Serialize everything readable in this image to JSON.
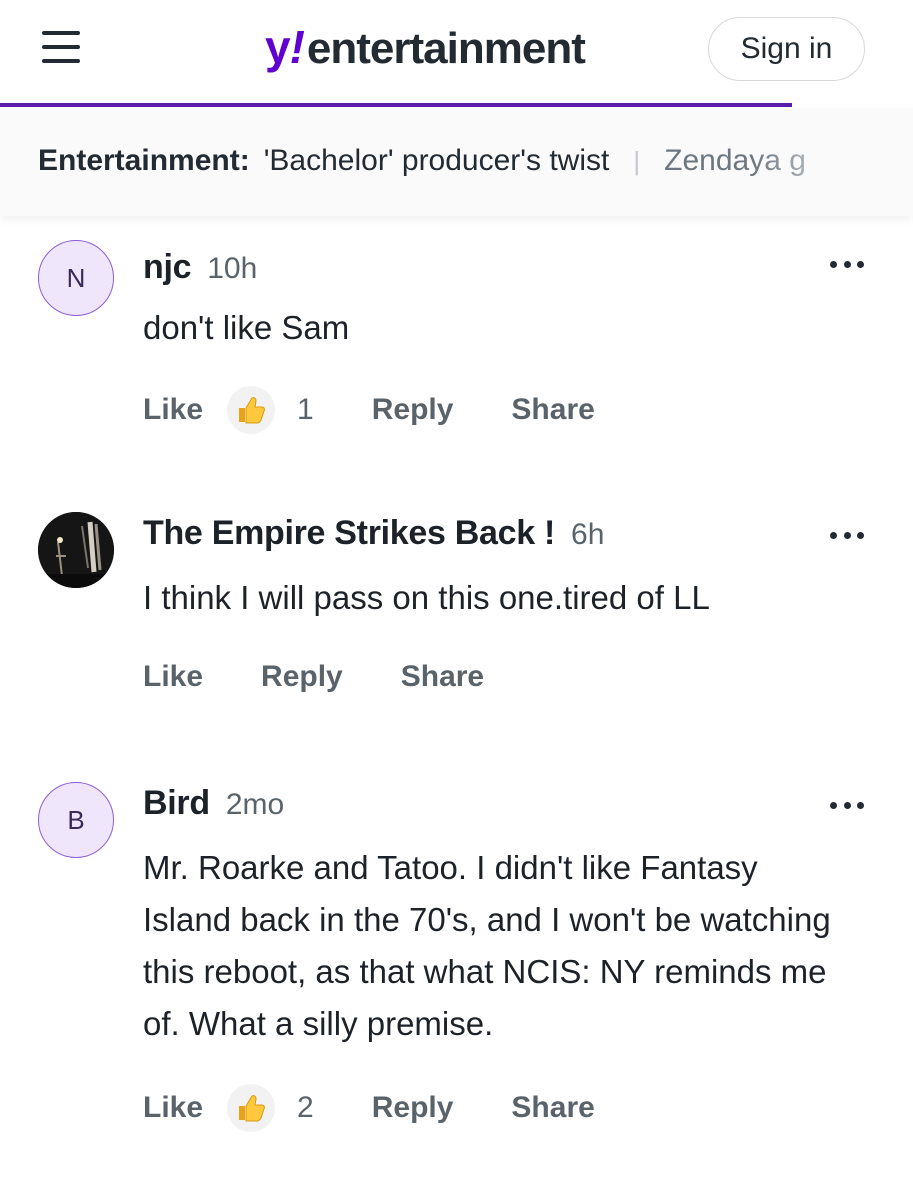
{
  "header": {
    "menu_icon": "hamburger-menu-icon",
    "logo_y": "y",
    "logo_bang": "!",
    "logo_word": "entertainment",
    "signin_label": "Sign in",
    "brand_color": "#6001d2"
  },
  "trending": {
    "label": "Entertainment:",
    "items": [
      "'Bachelor' producer's twist",
      "Zendaya g"
    ]
  },
  "comments": [
    {
      "avatar_letter": "N",
      "author": "njc",
      "time": "10h",
      "text": "don't like Sam",
      "like_label": "Like",
      "like_count": "1",
      "reply_label": "Reply",
      "share_label": "Share"
    },
    {
      "avatar_letter": "",
      "avatar_icon": "fireworks-photo-avatar",
      "author": "The Empire Strikes Back !",
      "time": "6h",
      "text": "I think I will pass on this one.tired of LL",
      "like_label": "Like",
      "like_count": "",
      "reply_label": "Reply",
      "share_label": "Share"
    },
    {
      "avatar_letter": "B",
      "author": "Bird",
      "time": "2mo",
      "text": "Mr. Roarke and Tatoo. I didn't like Fantasy Island back in the 70's, and I won't be watching this reboot, as that what NCIS: NY reminds me of. What a silly premise.",
      "like_label": "Like",
      "like_count": "2",
      "reply_label": "Reply",
      "share_label": "Share"
    }
  ]
}
